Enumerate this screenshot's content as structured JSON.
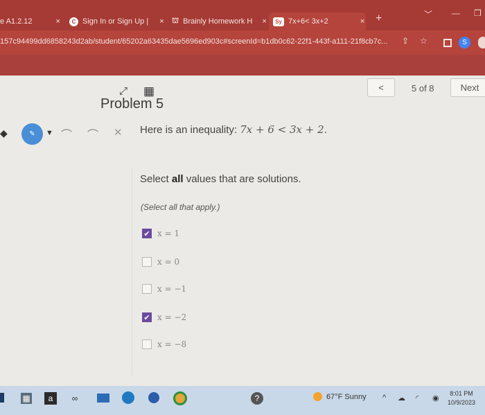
{
  "browser": {
    "tabs": [
      {
        "label": "e A1.2.12",
        "close": "×"
      },
      {
        "label": "Sign In or Sign Up |",
        "close": "×",
        "icon": "C"
      },
      {
        "label": "Brainly Homework H",
        "close": "×"
      },
      {
        "label": "7x+6< 3x+2",
        "close": "×",
        "icon": "Sy"
      }
    ],
    "new_tab": "+",
    "url": "157c94499dd6858243d2ab/student/65202a63435dae5696ed903c#screenId=b1db0c62-22f1-443f-a111-21f8cb7c...",
    "profile_initial": "S"
  },
  "nav": {
    "prev_label": "<",
    "position": "5 of 8",
    "next_label": "Next"
  },
  "problem": {
    "title": "Problem 5",
    "question_prefix": "Here is an inequality: ",
    "inequality": "7x + 6 < 3x + 2",
    "question_suffix": ".",
    "instruction_pre": "Select ",
    "instruction_bold": "all",
    "instruction_post": " values that are solutions.",
    "hint": "(Select all that apply.)",
    "options": [
      {
        "label": "x = 1",
        "checked": true
      },
      {
        "label": "x = 0",
        "checked": false
      },
      {
        "label": "x = −1",
        "checked": false
      },
      {
        "label": "x = −2",
        "checked": true
      },
      {
        "label": "x = −8",
        "checked": false
      }
    ]
  },
  "taskbar": {
    "weather": "67°F  Sunny",
    "time": "8:01 PM",
    "date": "10/9/2023"
  },
  "colors": {
    "browser_chrome": "#a63a34",
    "check_accent": "#6c4a9e",
    "draw_tool_circle": "#4a8ed6"
  }
}
